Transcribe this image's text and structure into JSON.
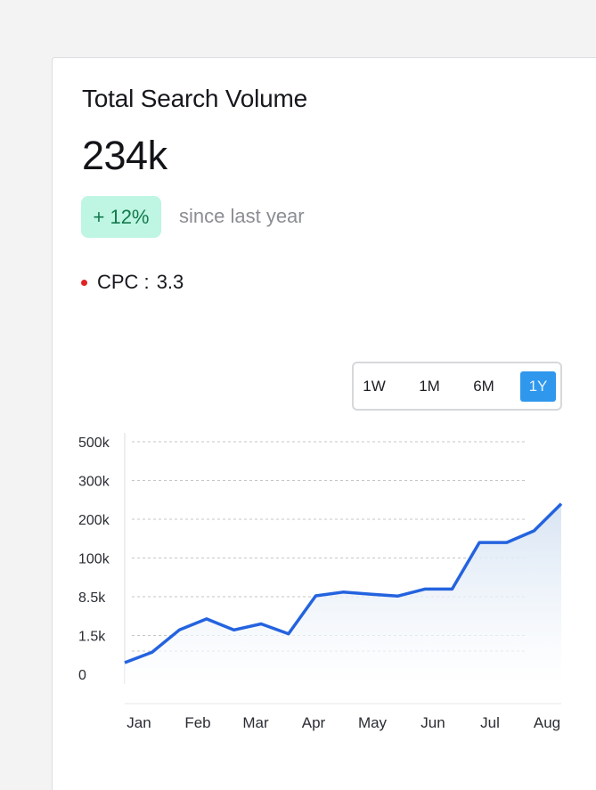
{
  "card": {
    "title": "Total Search Volume",
    "value": "234k",
    "change_badge": "+ 12%",
    "change_caption": "since last year",
    "cpc_label": "CPC :",
    "cpc_value": "3.3"
  },
  "colors": {
    "line": "#2463df",
    "area_top": "#d6e3f3",
    "badge_bg": "#bff5e3",
    "badge_text": "#127a4c",
    "active_range": "#2f97ec",
    "cpc_dot": "#e02424"
  },
  "range_buttons": [
    {
      "label": "1W",
      "active": false
    },
    {
      "label": "1M",
      "active": false
    },
    {
      "label": "6M",
      "active": false
    },
    {
      "label": "1Y",
      "active": true
    }
  ],
  "chart_data": {
    "type": "area",
    "y_tick_labels": [
      "500k",
      "300k",
      "200k",
      "100k",
      "8.5k",
      "1.5k",
      "0"
    ],
    "x_tick_labels": [
      "Jan",
      "Feb",
      "Mar",
      "Apr",
      "May",
      "Jun",
      "Jul",
      "Aug"
    ],
    "grid": "horizontal-dashed",
    "series": [
      {
        "values": [
          0.45,
          0.85,
          2.5,
          4.5,
          2.5,
          3.6,
          1.8,
          10.5,
          19.5,
          14.5,
          10,
          26.5,
          26.5,
          140,
          140,
          170,
          240
        ]
      }
    ]
  }
}
